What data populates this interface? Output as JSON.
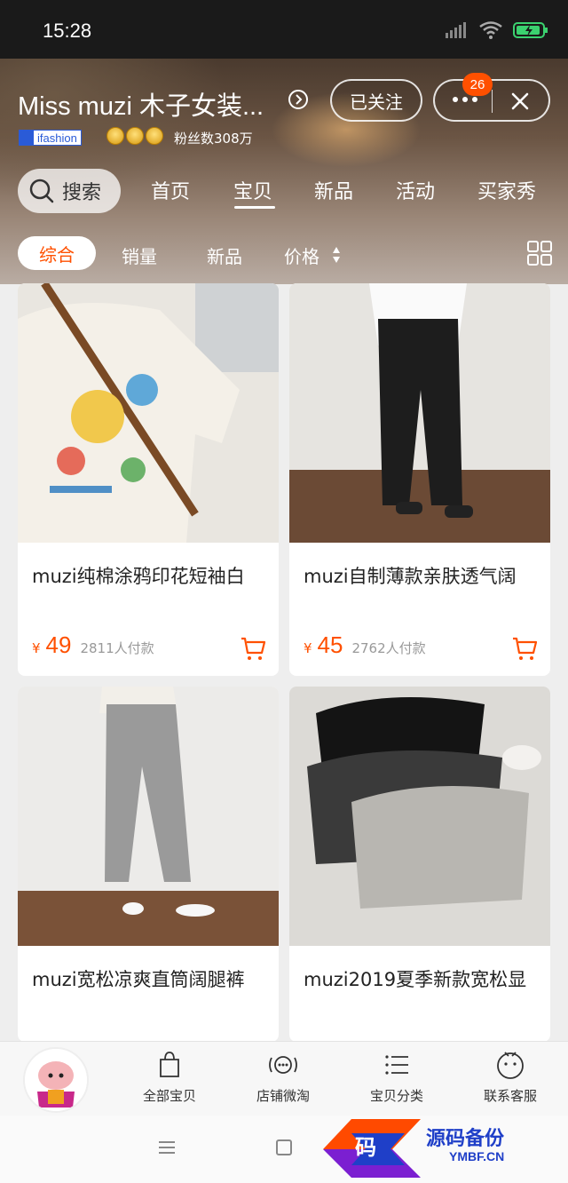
{
  "status_bar": {
    "time": "15:28"
  },
  "shop": {
    "name": "Miss muzi 木子女装...",
    "follow_label": "已关注",
    "message_badge": "26",
    "brand_tag": "ifashion",
    "fans": "粉丝数308万"
  },
  "nav": {
    "search_label": "搜索",
    "tabs": [
      "首页",
      "宝贝",
      "新品",
      "活动",
      "买家秀"
    ],
    "active_tab": "宝贝"
  },
  "sort": {
    "items": [
      "综合",
      "销量",
      "新品",
      "价格"
    ],
    "active": "综合"
  },
  "products": [
    {
      "title": "muzi纯棉涂鸦印花短袖白",
      "currency": "¥",
      "price": "49",
      "sold": "2811人付款"
    },
    {
      "title": "muzi自制薄款亲肤透气阔",
      "currency": "¥",
      "price": "45",
      "sold": "2762人付款"
    },
    {
      "title": "muzi宽松凉爽直筒阔腿裤",
      "currency": "¥",
      "price": "",
      "sold": ""
    },
    {
      "title": "muzi2019夏季新款宽松显",
      "currency": "¥",
      "price": "",
      "sold": ""
    }
  ],
  "bottom_bar": {
    "items": [
      "全部宝贝",
      "店铺微淘",
      "宝贝分类",
      "联系客服"
    ]
  },
  "watermark": {
    "title": "源码备份",
    "sub": "YMBF.CN",
    "char": "码"
  },
  "colors": {
    "accent": "#ff5000",
    "badge": "#ff5000"
  }
}
